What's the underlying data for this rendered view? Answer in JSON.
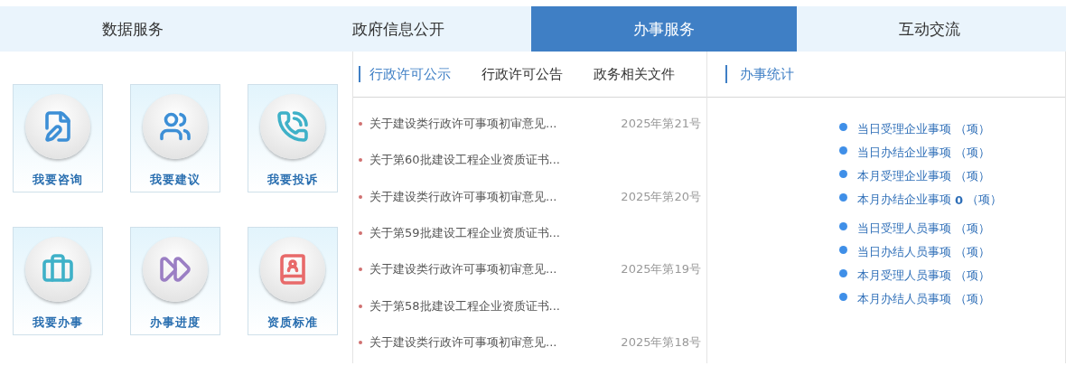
{
  "main_tabs": [
    {
      "label": "数据服务",
      "selected": false
    },
    {
      "label": "政府信息公开",
      "selected": false
    },
    {
      "label": "办事服务",
      "selected": true
    },
    {
      "label": "互动交流",
      "selected": false
    }
  ],
  "service_cards": [
    {
      "label": "我要咨询"
    },
    {
      "label": "我要建议"
    },
    {
      "label": "我要投诉"
    },
    {
      "label": "我要办事"
    },
    {
      "label": "办事进度"
    },
    {
      "label": "资质标准"
    }
  ],
  "notice_tabs": [
    {
      "label": "行政许可公示",
      "selected": true
    },
    {
      "label": "行政许可公告",
      "selected": false
    },
    {
      "label": "政务相关文件",
      "selected": false
    }
  ],
  "notices": [
    {
      "title": "关于建设类行政许可事项初审意见...",
      "number": "2025年第21号"
    },
    {
      "title": "关于第60批建设工程企业资质证书..."
    },
    {
      "title": "关于建设类行政许可事项初审意见...",
      "number": "2025年第20号"
    },
    {
      "title": "关于第59批建设工程企业资质证书..."
    },
    {
      "title": "关于建设类行政许可事项初审意见...",
      "number": "2025年第19号"
    },
    {
      "title": "关于第58批建设工程企业资质证书..."
    },
    {
      "title": "关于建设类行政许可事项初审意见...",
      "number": "2025年第18号"
    }
  ],
  "stats": {
    "title": "办事统计",
    "groups": [
      [
        {
          "label": "当日受理企业事项",
          "unit": "（项）"
        },
        {
          "label": "当日办结企业事项",
          "unit": "（项）"
        },
        {
          "label": "本月受理企业事项",
          "unit": "（项）"
        },
        {
          "label": "本月办结企业事项",
          "value": "0",
          "unit": "（项）"
        }
      ],
      [
        {
          "label": "当日受理人员事项",
          "unit": "（项）"
        },
        {
          "label": "当日办结人员事项",
          "unit": "（项）"
        },
        {
          "label": "本月受理人员事项",
          "unit": "（项）"
        },
        {
          "label": "本月办结人员事项",
          "unit": "（项）"
        }
      ]
    ]
  }
}
